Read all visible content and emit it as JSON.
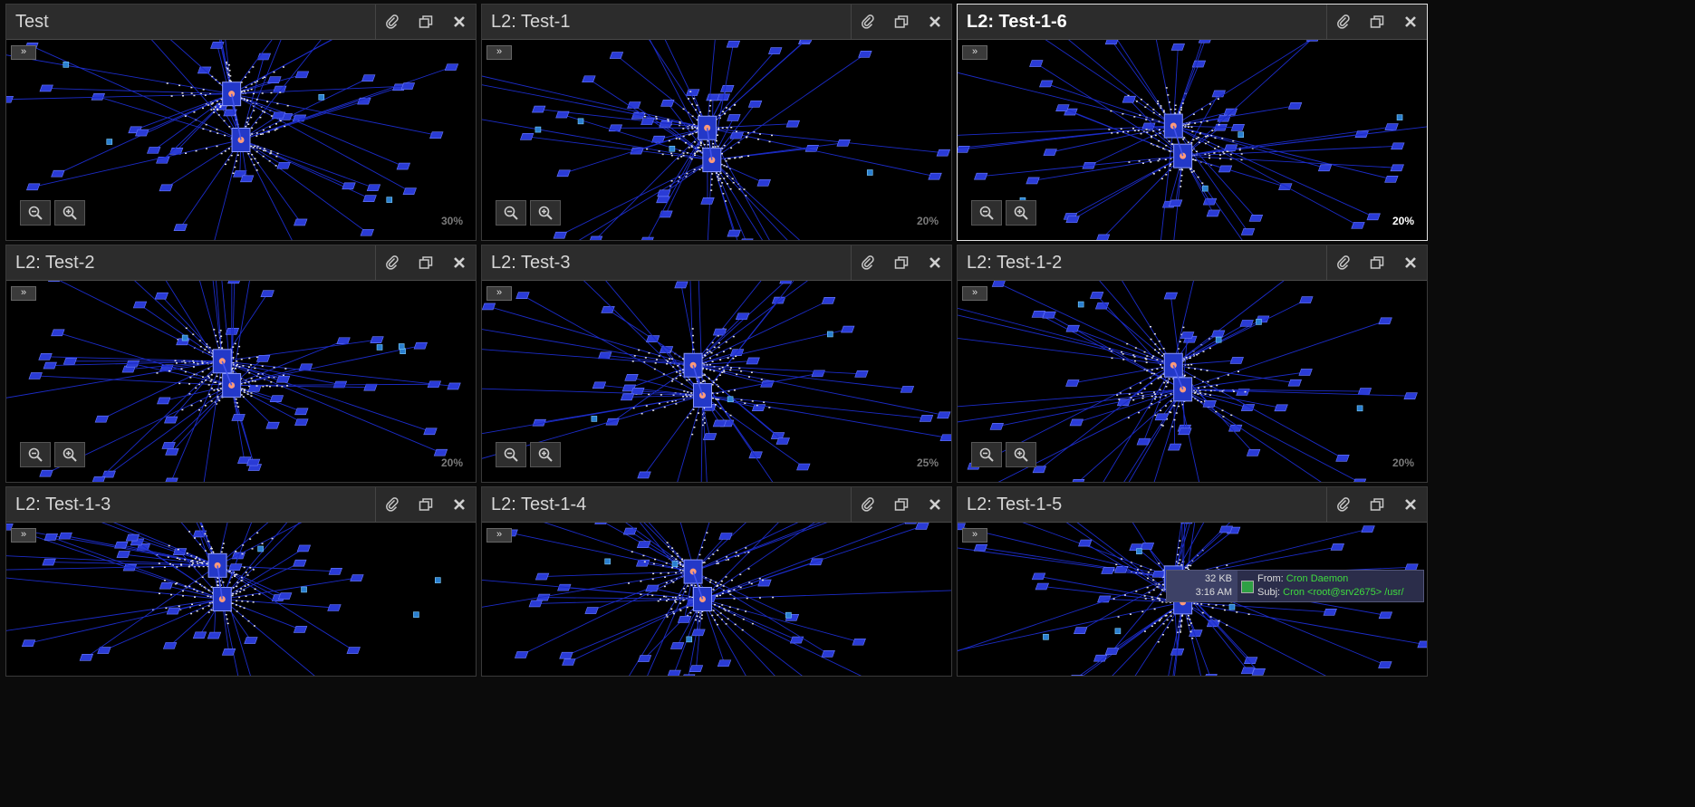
{
  "panels": [
    {
      "title": "Test",
      "zoom": "30%",
      "active": false
    },
    {
      "title": "L2: Test-1",
      "zoom": "20%",
      "active": false
    },
    {
      "title": "L2: Test-1-6",
      "zoom": "20%",
      "active": true
    },
    {
      "title": "L2: Test-2",
      "zoom": "20%",
      "active": false
    },
    {
      "title": "L2: Test-3",
      "zoom": "25%",
      "active": false
    },
    {
      "title": "L2: Test-1-2",
      "zoom": "20%",
      "active": false
    },
    {
      "title": "L2: Test-1-3",
      "zoom": "",
      "active": false
    },
    {
      "title": "L2: Test-1-4",
      "zoom": "",
      "active": false
    },
    {
      "title": "L2: Test-1-5",
      "zoom": "",
      "active": false
    }
  ],
  "icons": {
    "attach": "paperclip-icon",
    "restore": "restore-window-icon",
    "close": "close-icon",
    "expand": "expand-icon",
    "zoom_out": "zoom-out-icon",
    "zoom_in": "zoom-in-icon"
  },
  "expand_label": "»",
  "tooltip": {
    "size": "32 KB",
    "time": "3:16 AM",
    "from_label": "From:",
    "from_value": "Cron Daemon",
    "subj_label": "Subj:",
    "subj_value": "Cron <root@srv2675> /usr/"
  },
  "colors": {
    "node": "#2a3bd6",
    "link": "#1c2cc8",
    "hub_glow": "#ff9a7a",
    "panel_bg": "#000000",
    "titlebar": "#2c2c2c"
  }
}
